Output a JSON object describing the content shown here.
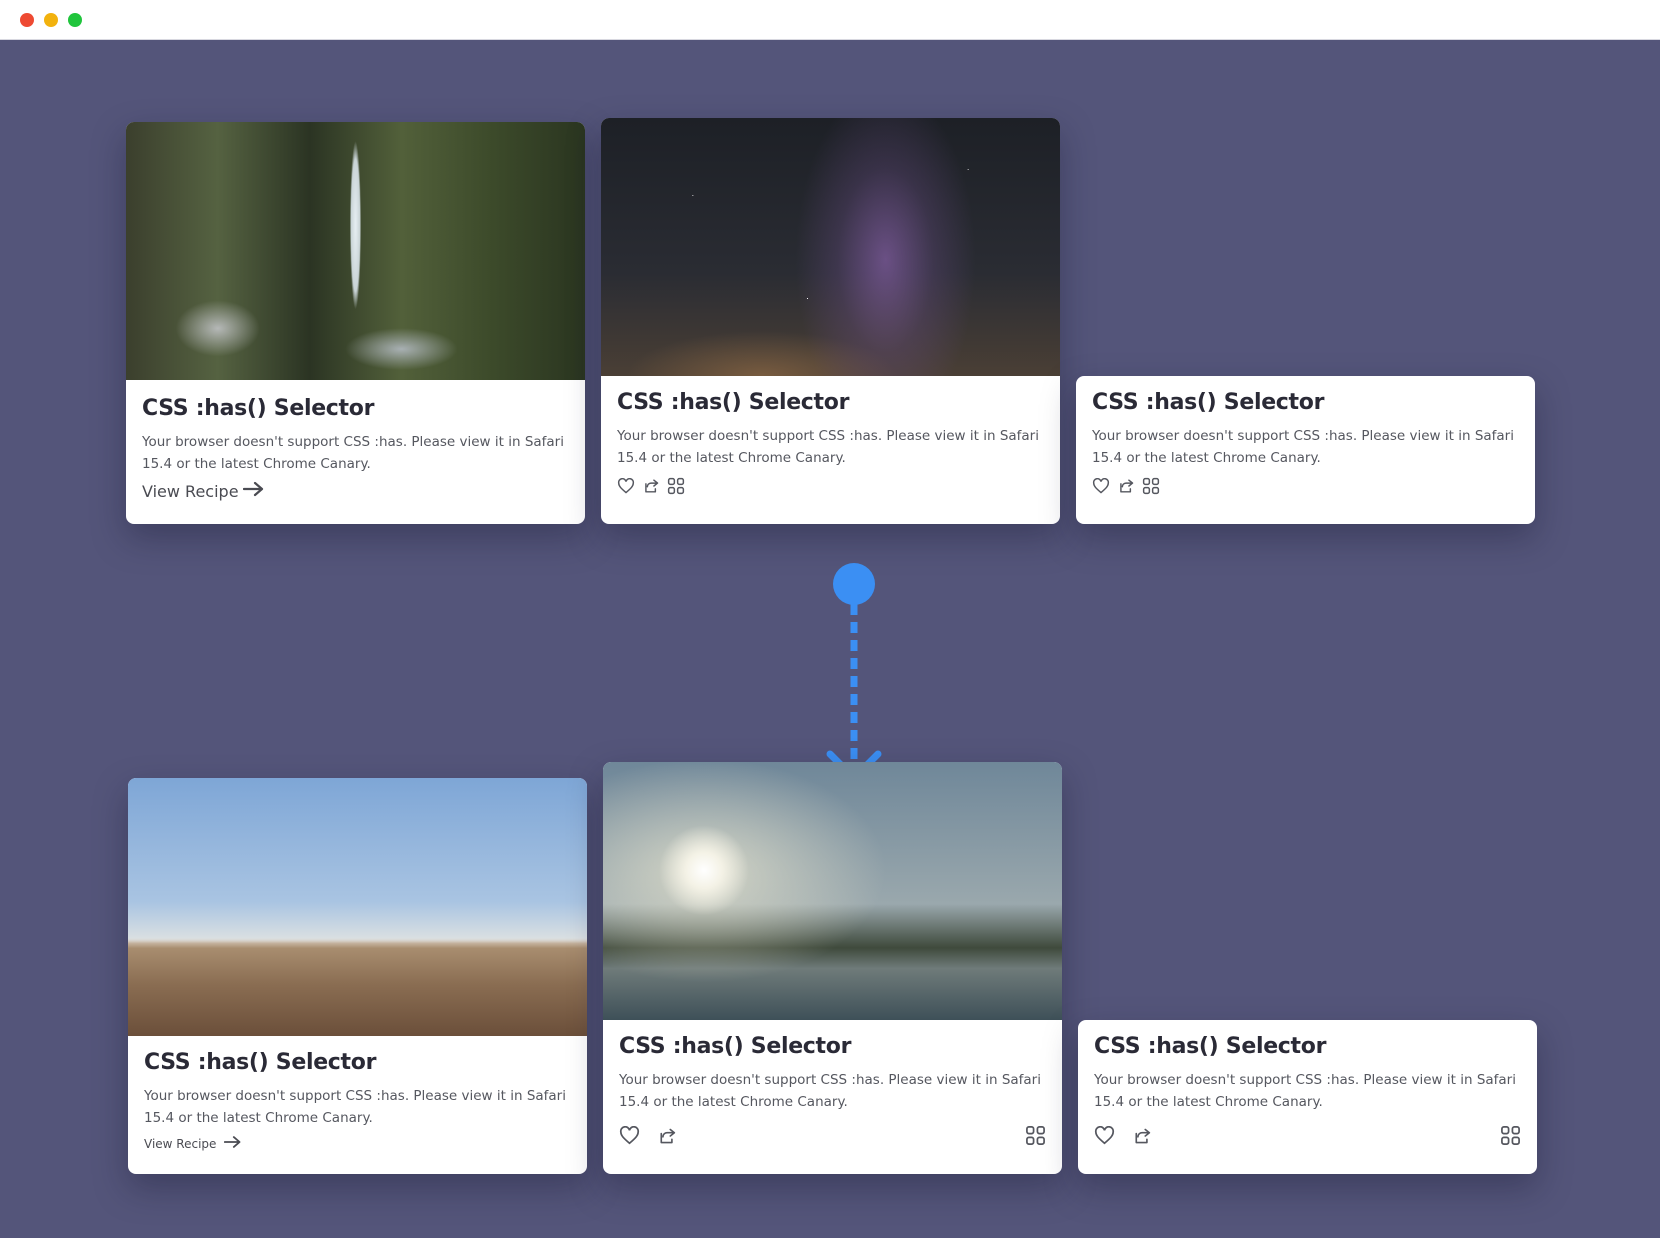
{
  "window": {
    "buttons": [
      "close",
      "minimize",
      "zoom"
    ]
  },
  "colors": {
    "background": "#54557a",
    "accent": "#3b8ff3",
    "card": "#ffffff"
  },
  "before": {
    "cards": [
      {
        "title": "CSS :has() Selector",
        "description": "Your browser doesn't support CSS :has. Please view it in Safari 15.4 or the latest Chrome Canary.",
        "link": "View Recipe",
        "image": "waterfall-photo"
      },
      {
        "title": "CSS :has() Selector",
        "description": "Your browser doesn't support CSS :has. Please view it in Safari 15.4 or the latest Chrome Canary.",
        "image": "milky-way-photo",
        "icons": [
          "heart-icon",
          "share-icon",
          "grid-icon"
        ]
      },
      {
        "title": "CSS :has() Selector",
        "description": "Your browser doesn't support CSS :has. Please view it in Safari 15.4 or the latest Chrome Canary.",
        "icons": [
          "heart-icon",
          "share-icon",
          "grid-icon"
        ]
      }
    ]
  },
  "after": {
    "cards": [
      {
        "title": "CSS :has() Selector",
        "description": "Your browser doesn't support CSS :has. Please view it in Safari 15.4 or the latest Chrome Canary.",
        "link": "View Recipe",
        "image": "hills-photo"
      },
      {
        "title": "CSS :has() Selector",
        "description": "Your browser doesn't support CSS :has. Please view it in Safari 15.4 or the latest Chrome Canary.",
        "image": "sunlit-coast-photo",
        "icons": [
          "heart-icon",
          "share-icon",
          "grid-icon"
        ]
      },
      {
        "title": "CSS :has() Selector",
        "description": "Your browser doesn't support CSS :has. Please view it in Safari 15.4 or the latest Chrome Canary.",
        "icons": [
          "heart-icon",
          "share-icon",
          "grid-icon"
        ]
      }
    ]
  }
}
